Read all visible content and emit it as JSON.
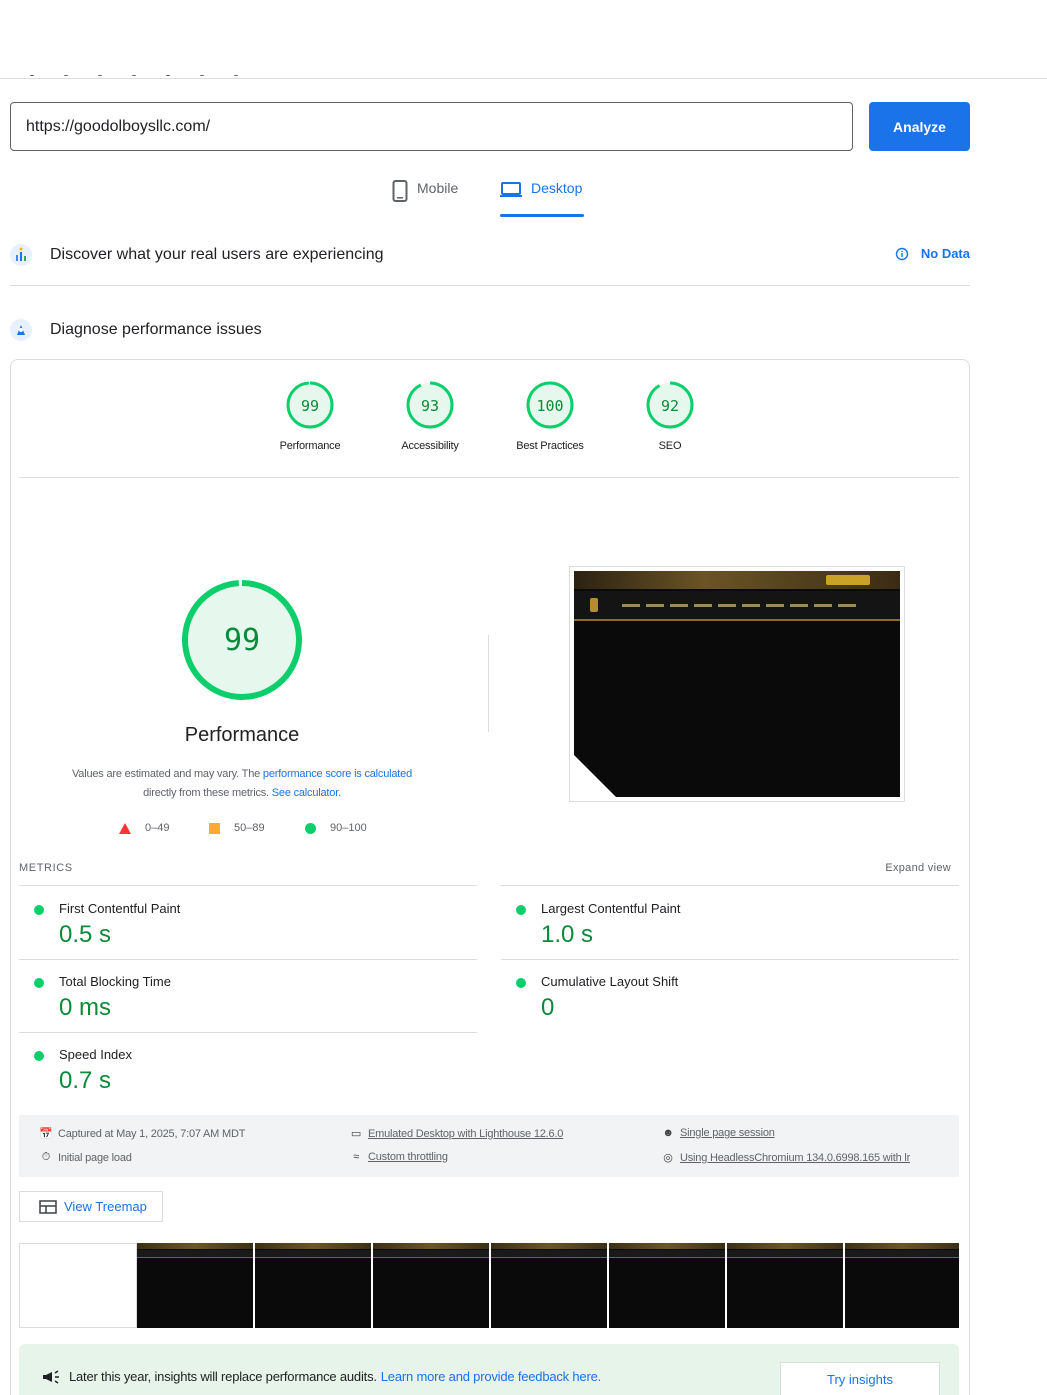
{
  "search": {
    "url_value": "https://goodolboysllc.com/",
    "analyze_label": "Analyze"
  },
  "device_tabs": [
    {
      "label": "Mobile",
      "icon": "phone-icon",
      "selected": false
    },
    {
      "label": "Desktop",
      "icon": "laptop-icon",
      "selected": true
    }
  ],
  "crux": {
    "title": "Discover what your real users are experiencing",
    "status_label": "No Data"
  },
  "lighthouse": {
    "title": "Diagnose performance issues"
  },
  "categories": [
    {
      "score": "99",
      "label": "Performance",
      "fraction": 0.99
    },
    {
      "score": "93",
      "label": "Accessibility",
      "fraction": 0.93
    },
    {
      "score": "100",
      "label": "Best Practices",
      "fraction": 1.0
    },
    {
      "score": "92",
      "label": "SEO",
      "fraction": 0.92
    }
  ],
  "performance": {
    "score": "99",
    "title": "Performance",
    "note_prefix": "Values are estimated and may vary. The ",
    "note_link1": "performance score is calculated",
    "note_middle": "directly from these metrics. ",
    "note_link2": "See calculator."
  },
  "legend": [
    {
      "range": "0–49",
      "shape": "triangle",
      "color": "#ff3333"
    },
    {
      "range": "50–89",
      "shape": "square",
      "color": "#ffaa33"
    },
    {
      "range": "90–100",
      "shape": "circle",
      "color": "#0cce6b"
    }
  ],
  "metrics": {
    "header": "METRICS",
    "expand_label": "Expand view",
    "items": [
      {
        "name": "First Contentful Paint",
        "value": "0.5 s"
      },
      {
        "name": "Largest Contentful Paint",
        "value": "1.0 s"
      },
      {
        "name": "Total Blocking Time",
        "value": "0 ms"
      },
      {
        "name": "Cumulative Layout Shift",
        "value": "0"
      },
      {
        "name": "Speed Index",
        "value": "0.7 s"
      }
    ]
  },
  "environment": {
    "captured": "Captured at May 1, 2025, 7:07 AM MDT",
    "initial_load": "Initial page load",
    "emulated": "Emulated Desktop with Lighthouse 12.6.0",
    "throttling": "Custom throttling",
    "session": "Single page session",
    "browser": "Using HeadlessChromium 134.0.6998.165 with lr"
  },
  "treemap_label": "View Treemap",
  "insights": {
    "text": "Later this year, insights will replace performance audits.",
    "link": "Learn more and provide feedback here.",
    "button": "Try insights"
  },
  "colors": {
    "accent": "#1a73e8",
    "pass": "#0cce6b",
    "pass_text": "#0a8a3a"
  }
}
